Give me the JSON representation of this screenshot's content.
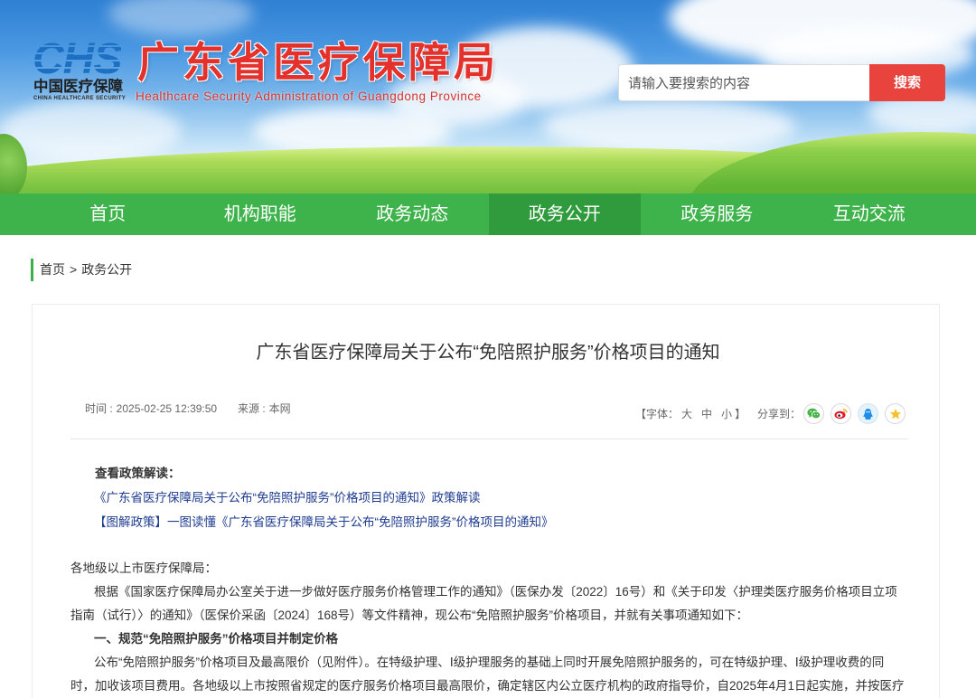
{
  "site": {
    "logo": {
      "mark": "CHS",
      "name_cn": "中国医疗保障",
      "name_en": "CHINA HEALTHCARE SECURITY"
    },
    "title": "广东省医疗保障局",
    "subtitle": "Healthcare Security Administration of Guangdong Province"
  },
  "search": {
    "placeholder": "请输入要搜索的内容",
    "button_label": "搜索"
  },
  "nav": {
    "items": [
      {
        "label": "首页",
        "active": false
      },
      {
        "label": "机构职能",
        "active": false
      },
      {
        "label": "政务动态",
        "active": false
      },
      {
        "label": "政务公开",
        "active": true
      },
      {
        "label": "政务服务",
        "active": false
      },
      {
        "label": "互动交流",
        "active": false
      }
    ]
  },
  "breadcrumb": {
    "items": [
      {
        "label": "首页"
      },
      {
        "label": "政务公开"
      }
    ],
    "separator": ">"
  },
  "article": {
    "title": "广东省医疗保障局关于公布“免陪照护服务”价格项目的通知",
    "meta": {
      "time_label": "时间 :",
      "time": "2025-02-25 12:39:50",
      "source_label": "来源 :",
      "source": "本网"
    },
    "font_size": {
      "open": "【字体：",
      "large": "大",
      "medium": "中",
      "small": "小",
      "close": "】"
    },
    "share": {
      "label": "分享到：",
      "targets": [
        {
          "icon": "wechat-icon"
        },
        {
          "icon": "weibo-icon"
        },
        {
          "icon": "qq-icon"
        },
        {
          "icon": "qzone-icon"
        }
      ]
    },
    "policy_reading": {
      "heading": "查看政策解读：",
      "links": [
        {
          "text": "《广东省医疗保障局关于公布“免陪照护服务”价格项目的通知》政策解读"
        },
        {
          "text": "【图解政策】一图读懂《广东省医疗保障局关于公布“免陪照护服务”价格项目的通知》"
        }
      ]
    },
    "body": {
      "salutation": "各地级以上市医疗保障局：",
      "paragraph_1": {
        "lines": [
          "根据《国家医疗保障局办公室关于进一步做好医疗服务价格管理工作的通知》（医保办发〔2022〕16号）和《关于印发〈护理类医疗服务价格项目立项",
          "指南（试行）〉的通知》（医保价采函〔2024〕168号）等文件精神，现公布“免陪照护服务”价格项目，并就有关事项通知如下："
        ]
      },
      "section_1_heading": "一、规范“免陪照护服务”价格项目并制定价格",
      "paragraph_2": {
        "lines": [
          "公布“免陪照护服务”价格项目及最高限价（见附件）。在特级护理、Ⅰ级护理服务的基础上同时开展免陪照护服务的，可在特级护理、Ⅰ级护理收费的同",
          "时，加收该项目费用。各地级以上市按照省规定的医疗服务价格项目最高限价，确定辖区内公立医疗机构的政府指导价，自2025年4月1日起实施，并按医疗"
        ]
      }
    }
  },
  "colors": {
    "nav": "#3fb34b",
    "nav_active": "#2f9b3d",
    "title_red": "#e4312b",
    "search_red": "#e8433d",
    "link": "#1f3d91",
    "accent": "#3cb04a",
    "logo_blue": "#1d6fc2"
  }
}
